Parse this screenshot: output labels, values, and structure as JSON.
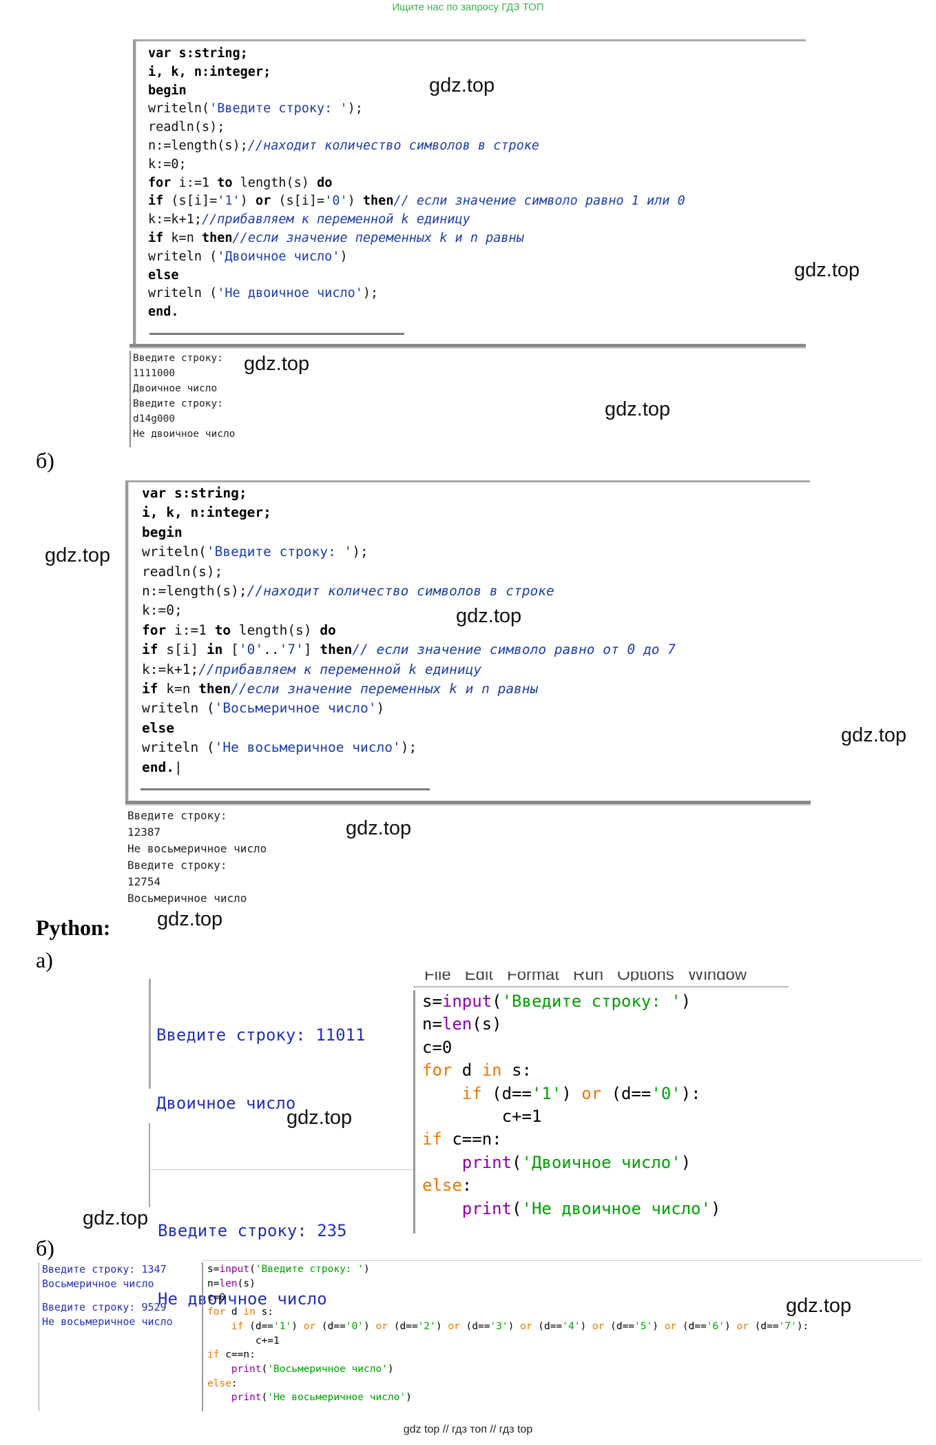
{
  "header": {
    "banner": "Ищите нас по запросу ГДЗ ТОП"
  },
  "watermarks": [
    "gdz.top",
    "gdz.top",
    "gdz.top",
    "gdz.top",
    "gdz.top",
    "gdz.top",
    "gdz.top",
    "gdz.top",
    "gdz.top",
    "gdz.top",
    "gdz.top",
    "gdz.top"
  ],
  "labels": {
    "b1": "б)",
    "python": "Python:",
    "a": "а)",
    "b2": "б)"
  },
  "pascal_a": {
    "code": [
      [
        {
          "t": "var s:string;",
          "c": "kw"
        }
      ],
      [
        {
          "t": "i, k, n:integer;",
          "c": "kw"
        }
      ],
      [
        {
          "t": "begin",
          "c": "kw"
        }
      ],
      [
        {
          "t": "writeln(",
          "c": ""
        },
        {
          "t": "'Введите строку: '",
          "c": "str"
        },
        {
          "t": ");",
          "c": ""
        }
      ],
      [
        {
          "t": "readln(s);",
          "c": ""
        }
      ],
      [
        {
          "t": "n:=length(s);",
          "c": ""
        },
        {
          "t": "//находит количество символов в строке",
          "c": "cm"
        }
      ],
      [
        {
          "t": "k:=0;",
          "c": ""
        }
      ],
      [
        {
          "t": "for",
          "c": "kw"
        },
        {
          "t": " i:=1 ",
          "c": ""
        },
        {
          "t": "to",
          "c": "kw"
        },
        {
          "t": " length(s) ",
          "c": ""
        },
        {
          "t": "do",
          "c": "kw"
        }
      ],
      [
        {
          "t": "if",
          "c": "kw"
        },
        {
          "t": " (s[i]=",
          "c": ""
        },
        {
          "t": "'1'",
          "c": "str"
        },
        {
          "t": ") ",
          "c": ""
        },
        {
          "t": "or",
          "c": "kw"
        },
        {
          "t": " (s[i]=",
          "c": ""
        },
        {
          "t": "'0'",
          "c": "str"
        },
        {
          "t": ") ",
          "c": ""
        },
        {
          "t": "then",
          "c": "kw"
        },
        {
          "t": "// если значение символо равно 1 или 0",
          "c": "cm"
        }
      ],
      [
        {
          "t": "k:=k+1;",
          "c": ""
        },
        {
          "t": "//прибавляем к переменной k единицу",
          "c": "cm"
        }
      ],
      [
        {
          "t": "if",
          "c": "kw"
        },
        {
          "t": " k=n ",
          "c": ""
        },
        {
          "t": "then",
          "c": "kw"
        },
        {
          "t": "//если значение переменных k и n равны",
          "c": "cm"
        }
      ],
      [
        {
          "t": "writeln (",
          "c": ""
        },
        {
          "t": "'Двоичное число'",
          "c": "str"
        },
        {
          "t": ")",
          "c": ""
        }
      ],
      [
        {
          "t": "else",
          "c": "kw"
        }
      ],
      [
        {
          "t": "writeln (",
          "c": ""
        },
        {
          "t": "'Не двоичное число'",
          "c": "str"
        },
        {
          "t": ");",
          "c": ""
        }
      ],
      [
        {
          "t": "end.",
          "c": "kw"
        }
      ]
    ],
    "output": [
      "Введите строку:",
      "1111000",
      "Двоичное число",
      "Введите строку:",
      "d14g000",
      "Не двоичное число"
    ]
  },
  "pascal_b": {
    "code": [
      [
        {
          "t": "var s:string;",
          "c": "kw"
        }
      ],
      [
        {
          "t": "i, k, n:integer;",
          "c": "kw"
        }
      ],
      [
        {
          "t": "begin",
          "c": "kw"
        }
      ],
      [
        {
          "t": "writeln(",
          "c": ""
        },
        {
          "t": "'Введите строку: '",
          "c": "str"
        },
        {
          "t": ");",
          "c": ""
        }
      ],
      [
        {
          "t": "readln(s);",
          "c": ""
        }
      ],
      [
        {
          "t": "n:=length(s);",
          "c": ""
        },
        {
          "t": "//находит количество символов в строке",
          "c": "cm"
        }
      ],
      [
        {
          "t": "k:=0;",
          "c": ""
        }
      ],
      [
        {
          "t": "for",
          "c": "kw"
        },
        {
          "t": " i:=1 ",
          "c": ""
        },
        {
          "t": "to",
          "c": "kw"
        },
        {
          "t": " length(s) ",
          "c": ""
        },
        {
          "t": "do",
          "c": "kw"
        }
      ],
      [
        {
          "t": "if",
          "c": "kw"
        },
        {
          "t": " s[i] ",
          "c": ""
        },
        {
          "t": "in",
          "c": "kw"
        },
        {
          "t": " [",
          "c": ""
        },
        {
          "t": "'0'",
          "c": "str"
        },
        {
          "t": "..",
          "c": ""
        },
        {
          "t": "'7'",
          "c": "str"
        },
        {
          "t": "] ",
          "c": ""
        },
        {
          "t": "then",
          "c": "kw"
        },
        {
          "t": "// если значение символо равно от 0 до 7",
          "c": "cm"
        }
      ],
      [
        {
          "t": "k:=k+1;",
          "c": ""
        },
        {
          "t": "//прибавляем к переменной k единицу",
          "c": "cm"
        }
      ],
      [
        {
          "t": "if",
          "c": "kw"
        },
        {
          "t": " k=n ",
          "c": ""
        },
        {
          "t": "then",
          "c": "kw"
        },
        {
          "t": "//если значение переменных k и n равны",
          "c": "cm"
        }
      ],
      [
        {
          "t": "writeln (",
          "c": ""
        },
        {
          "t": "'Восьмеричное число'",
          "c": "str"
        },
        {
          "t": ")",
          "c": ""
        }
      ],
      [
        {
          "t": "else",
          "c": "kw"
        }
      ],
      [
        {
          "t": "writeln (",
          "c": ""
        },
        {
          "t": "'Не восьмеричное число'",
          "c": "str"
        },
        {
          "t": ");",
          "c": ""
        }
      ],
      [
        {
          "t": "end.",
          "c": "kw"
        },
        {
          "t": "|",
          "c": ""
        }
      ]
    ],
    "output": [
      "Введите строку:",
      "12387",
      "Не восьмеричное число",
      "Введите строку:",
      "12754",
      "Восьмеричное число"
    ]
  },
  "python_a": {
    "menu": "File   Edit   Format   Run   Options   Window",
    "shell": [
      "Введите строку: 11011",
      "Двоичное число",
      "Введите строку: 235",
      "Не двоичное число"
    ],
    "code": [
      [
        {
          "t": "s=",
          "c": ""
        },
        {
          "t": "input",
          "c": "pbi"
        },
        {
          "t": "(",
          "c": ""
        },
        {
          "t": "'Введите строку: '",
          "c": "pstr"
        },
        {
          "t": ")",
          "c": ""
        }
      ],
      [
        {
          "t": "n=",
          "c": ""
        },
        {
          "t": "len",
          "c": "pbi"
        },
        {
          "t": "(s)",
          "c": ""
        }
      ],
      [
        {
          "t": "c=0",
          "c": ""
        }
      ],
      [
        {
          "t": "for",
          "c": "pkw"
        },
        {
          "t": " d ",
          "c": ""
        },
        {
          "t": "in",
          "c": "pkw"
        },
        {
          "t": " s:",
          "c": ""
        }
      ],
      [
        {
          "t": "    ",
          "c": ""
        },
        {
          "t": "if",
          "c": "pkw"
        },
        {
          "t": " (d==",
          "c": ""
        },
        {
          "t": "'1'",
          "c": "pstr"
        },
        {
          "t": ") ",
          "c": ""
        },
        {
          "t": "or",
          "c": "pkw"
        },
        {
          "t": " (d==",
          "c": ""
        },
        {
          "t": "'0'",
          "c": "pstr"
        },
        {
          "t": "):",
          "c": ""
        }
      ],
      [
        {
          "t": "        c+=1",
          "c": ""
        }
      ],
      [
        {
          "t": "if",
          "c": "pkw"
        },
        {
          "t": " c==n:",
          "c": ""
        }
      ],
      [
        {
          "t": "    ",
          "c": ""
        },
        {
          "t": "print",
          "c": "pbi"
        },
        {
          "t": "(",
          "c": ""
        },
        {
          "t": "'Двоичное число'",
          "c": "pstr"
        },
        {
          "t": ")",
          "c": ""
        }
      ],
      [
        {
          "t": "else",
          "c": "pkw"
        },
        {
          "t": ":",
          "c": ""
        }
      ],
      [
        {
          "t": "    ",
          "c": ""
        },
        {
          "t": "print",
          "c": "pbi"
        },
        {
          "t": "(",
          "c": ""
        },
        {
          "t": "'Не двоичное число'",
          "c": "pstr"
        },
        {
          "t": ")",
          "c": ""
        }
      ]
    ]
  },
  "python_b": {
    "shell": [
      "Введите строку: 1347",
      "Восьмеричное число",
      "",
      "Введите строку: 9529",
      "Не восьмеричное число"
    ],
    "code": [
      [
        {
          "t": "s=",
          "c": ""
        },
        {
          "t": "input",
          "c": "pbi"
        },
        {
          "t": "(",
          "c": ""
        },
        {
          "t": "'Введите строку: '",
          "c": "pstr"
        },
        {
          "t": ")",
          "c": ""
        }
      ],
      [
        {
          "t": "n=",
          "c": ""
        },
        {
          "t": "len",
          "c": "pbi"
        },
        {
          "t": "(s)",
          "c": ""
        }
      ],
      [
        {
          "t": "c=0",
          "c": ""
        }
      ],
      [
        {
          "t": "for",
          "c": "pkw"
        },
        {
          "t": " d ",
          "c": ""
        },
        {
          "t": "in",
          "c": "pkw"
        },
        {
          "t": " s:",
          "c": ""
        }
      ],
      [
        {
          "t": "    ",
          "c": ""
        },
        {
          "t": "if",
          "c": "pkw"
        },
        {
          "t": " (d==",
          "c": ""
        },
        {
          "t": "'1'",
          "c": "pstr"
        },
        {
          "t": ") ",
          "c": ""
        },
        {
          "t": "or",
          "c": "pkw"
        },
        {
          "t": " (d==",
          "c": ""
        },
        {
          "t": "'0'",
          "c": "pstr"
        },
        {
          "t": ") ",
          "c": ""
        },
        {
          "t": "or",
          "c": "pkw"
        },
        {
          "t": " (d==",
          "c": ""
        },
        {
          "t": "'2'",
          "c": "pstr"
        },
        {
          "t": ") ",
          "c": ""
        },
        {
          "t": "or",
          "c": "pkw"
        },
        {
          "t": " (d==",
          "c": ""
        },
        {
          "t": "'3'",
          "c": "pstr"
        },
        {
          "t": ") ",
          "c": ""
        },
        {
          "t": "or",
          "c": "pkw"
        },
        {
          "t": " (d==",
          "c": ""
        },
        {
          "t": "'4'",
          "c": "pstr"
        },
        {
          "t": ") ",
          "c": ""
        },
        {
          "t": "or",
          "c": "pkw"
        },
        {
          "t": " (d==",
          "c": ""
        },
        {
          "t": "'5'",
          "c": "pstr"
        },
        {
          "t": ") ",
          "c": ""
        },
        {
          "t": "or",
          "c": "pkw"
        },
        {
          "t": " (d==",
          "c": ""
        },
        {
          "t": "'6'",
          "c": "pstr"
        },
        {
          "t": ") ",
          "c": ""
        },
        {
          "t": "or",
          "c": "pkw"
        },
        {
          "t": " (d==",
          "c": ""
        },
        {
          "t": "'7'",
          "c": "pstr"
        },
        {
          "t": "):",
          "c": ""
        }
      ],
      [
        {
          "t": "        c+=1",
          "c": ""
        }
      ],
      [
        {
          "t": "if",
          "c": "pkw"
        },
        {
          "t": " c==n:",
          "c": ""
        }
      ],
      [
        {
          "t": "    ",
          "c": ""
        },
        {
          "t": "print",
          "c": "pbi"
        },
        {
          "t": "(",
          "c": ""
        },
        {
          "t": "'Восьмеричное число'",
          "c": "pstr"
        },
        {
          "t": ")",
          "c": ""
        }
      ],
      [
        {
          "t": "else",
          "c": "pkw"
        },
        {
          "t": ":",
          "c": ""
        }
      ],
      [
        {
          "t": "    ",
          "c": ""
        },
        {
          "t": "print",
          "c": "pbi"
        },
        {
          "t": "(",
          "c": ""
        },
        {
          "t": "'Не восьмеричное число'",
          "c": "pstr"
        },
        {
          "t": ")",
          "c": ""
        }
      ]
    ]
  },
  "footer": {
    "text": "gdz top  //  гдз топ  //  гдз top"
  },
  "colors": {
    "banner": "#3bb34a",
    "pascal_string": "#1c3dad",
    "py_keyword": "#ee7700",
    "py_builtin": "#8a00aa",
    "py_string": "#00a000",
    "shell_text": "#2230b8"
  }
}
